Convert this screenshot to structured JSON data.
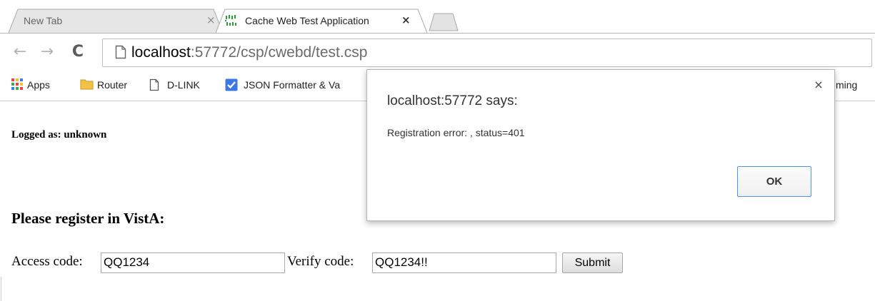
{
  "browser": {
    "tabs": [
      {
        "title": "New Tab",
        "close_glyph": "×",
        "active": false
      },
      {
        "title": "Cache Web Test Application",
        "close_glyph": "×",
        "active": true,
        "icon": "cache-favicon-icon"
      }
    ],
    "new_tab_icon": "new-tab-icon",
    "nav": {
      "back_glyph": "←",
      "forward_glyph": "→",
      "reload_glyph": "C"
    },
    "address": {
      "icon": "page-icon",
      "host": "localhost",
      "rest": ":57772/csp/cwebd/test.csp"
    },
    "bookmarks": [
      {
        "label": "Apps",
        "icon": "apps-grid-icon"
      },
      {
        "label": "Router",
        "icon": "folder-icon"
      },
      {
        "label": "D-LINK",
        "icon": "page-icon"
      },
      {
        "label": "JSON Formatter & Va",
        "icon": "checkbox-icon"
      },
      {
        "label": "ming",
        "icon": ""
      }
    ]
  },
  "page": {
    "logged_as": "Logged as: unknown",
    "heading": "Please register in VistA:",
    "form": {
      "access_label": "Access code:",
      "access_value": "QQ1234",
      "verify_label": "Verify code:",
      "verify_value": "QQ1234!!",
      "submit_label": "Submit"
    }
  },
  "dialog": {
    "title": "localhost:57772 says:",
    "message": "Registration error: , status=401",
    "close_glyph": "×",
    "ok_label": "OK"
  },
  "colors": {
    "tab_strip": "#ffffff",
    "inactive_tab": "#e6e6e6",
    "active_tab": "#ffffff",
    "favicon": "#2e9a3a",
    "apps_icon": [
      "#e8453c",
      "#f9bb2d",
      "#3b7ded",
      "#3aa757"
    ],
    "folder_icon": "#f3c245",
    "checkbox_icon": "#3b78e7",
    "ok_button_border": "#4d90fe"
  }
}
